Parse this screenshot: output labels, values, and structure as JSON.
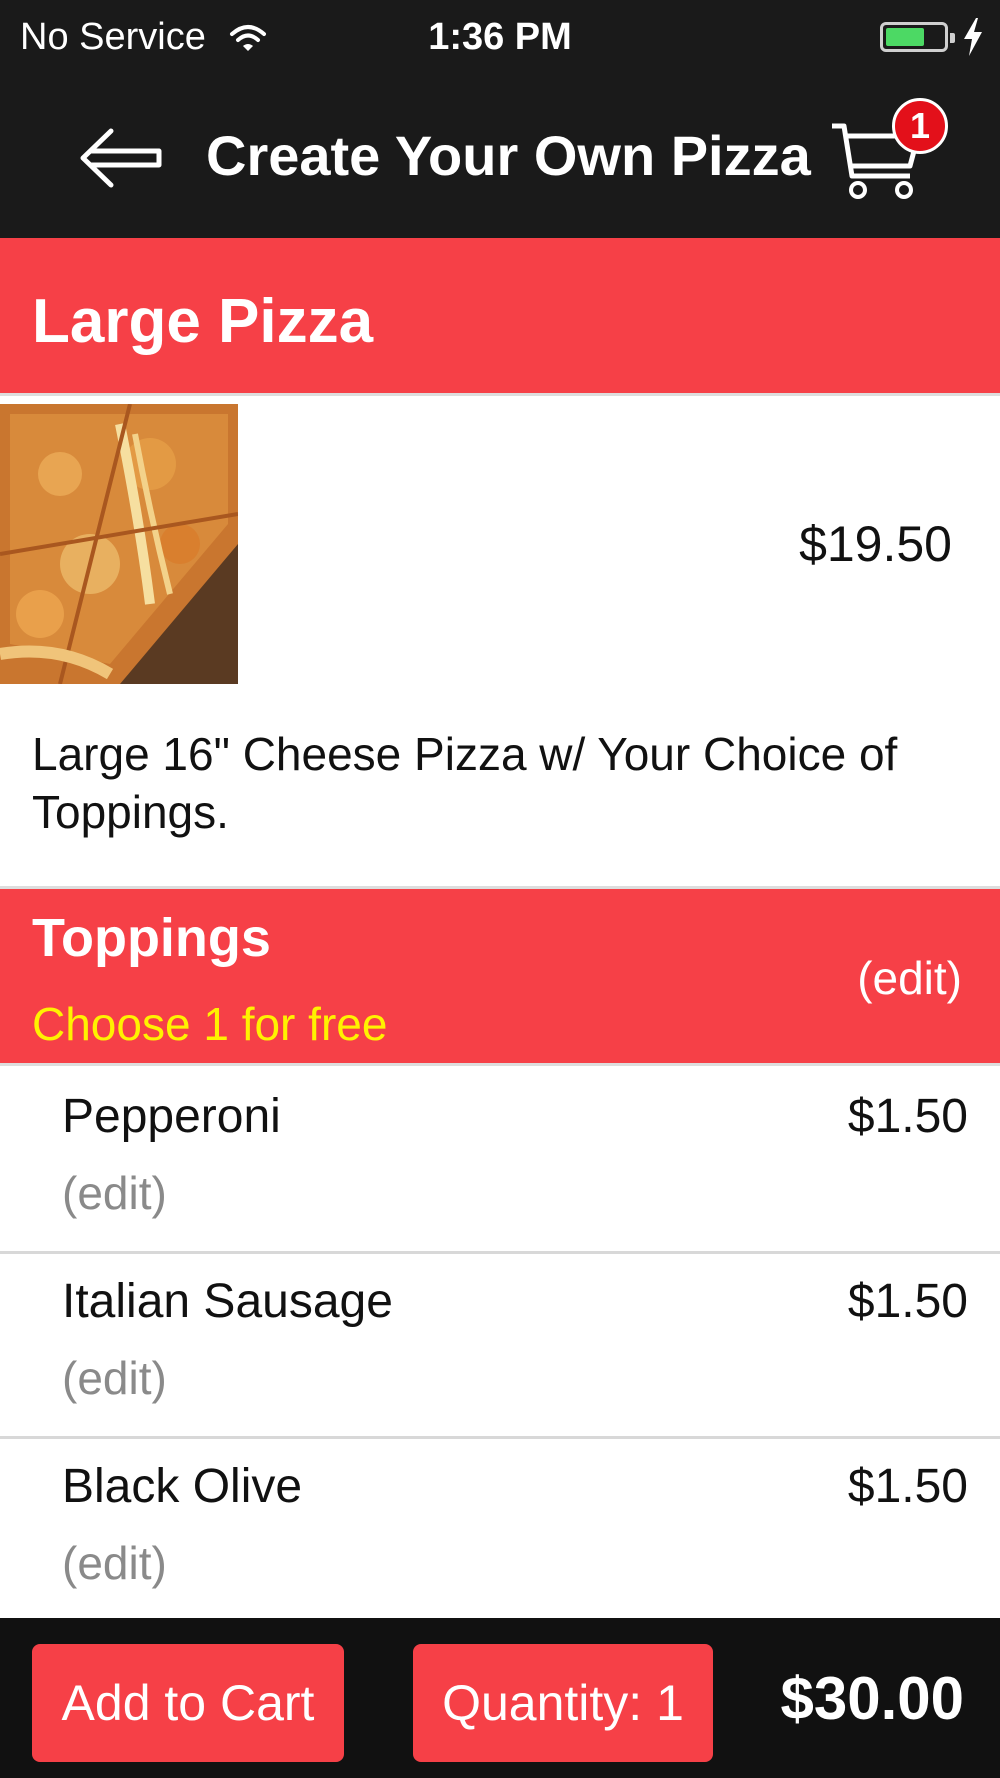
{
  "status_bar": {
    "carrier": "No Service",
    "time": "1:36 PM",
    "wifi_icon": "wifi-icon",
    "battery_icon": "battery-icon",
    "charging_icon": "charging-bolt-icon"
  },
  "nav": {
    "back_icon": "back-arrow-icon",
    "title": "Create Your Own Pizza",
    "cart_icon": "shopping-cart-icon",
    "cart_count": "1"
  },
  "product": {
    "title": "Large Pizza",
    "image_icon": "pizza-photo",
    "price": "$19.50",
    "description": "Large 16\" Cheese Pizza w/ Your Choice of Toppings."
  },
  "toppings": {
    "title": "Toppings",
    "subtitle": "Choose 1 for free",
    "edit_label": "(edit)",
    "items": [
      {
        "name": "Pepperoni",
        "price": "$1.50",
        "edit_label": "(edit)"
      },
      {
        "name": "Italian Sausage",
        "price": "$1.50",
        "edit_label": "(edit)"
      },
      {
        "name": "Black Olive",
        "price": "$1.50",
        "edit_label": "(edit)"
      }
    ]
  },
  "bottom_bar": {
    "add_to_cart_label": "Add to Cart",
    "quantity_label": "Quantity: 1",
    "total": "$30.00"
  },
  "colors": {
    "accent": "#f64047",
    "bar_background": "#1a1a1a",
    "subtitle_yellow": "#fff200",
    "badge_red": "#e3101a",
    "battery_green": "#4cd964"
  }
}
